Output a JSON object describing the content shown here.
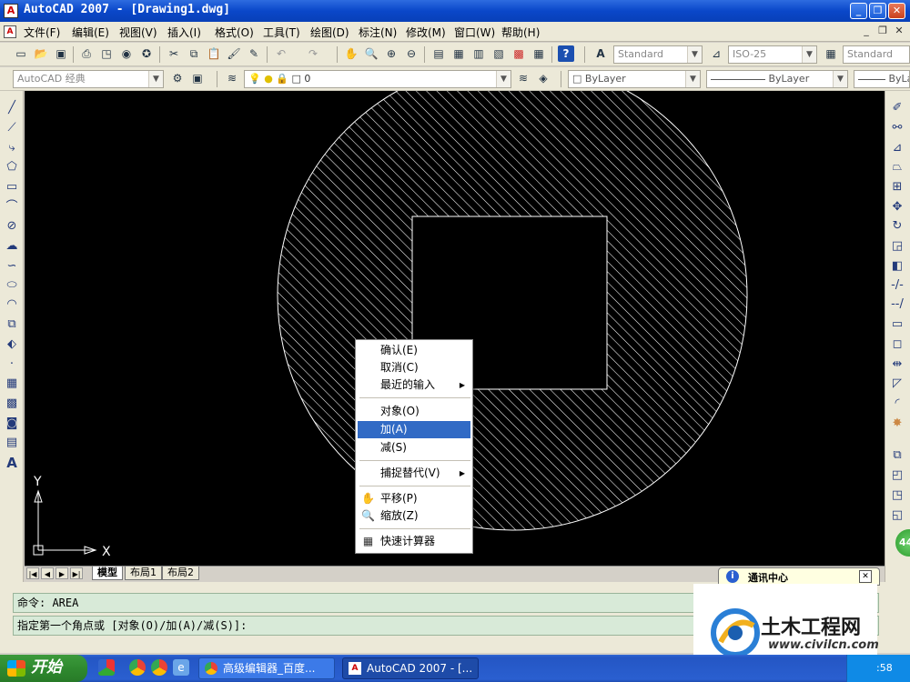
{
  "window": {
    "title": "AutoCAD 2007 - [Drawing1.dwg]",
    "icon_label": "A",
    "buttons": {
      "minimize": "_",
      "restore": "❐",
      "close": "✕"
    }
  },
  "menu": {
    "items": [
      "文件(F)",
      "编辑(E)",
      "视图(V)",
      "插入(I)",
      "格式(O)",
      "工具(T)",
      "绘图(D)",
      "标注(N)",
      "修改(M)",
      "窗口(W)",
      "帮助(H)"
    ],
    "mdi": {
      "minimize": "_",
      "restore": "❐",
      "close": "✕"
    }
  },
  "toolbar": {
    "text_style": "Standard",
    "dim_style": "ISO-25",
    "table_style": "Standard",
    "workspace": "AutoCAD 经典",
    "layer": "0",
    "color": "ByLayer",
    "linetype": "ByLayer",
    "lineweight": "ByLa"
  },
  "ucs": {
    "y_label": "Y",
    "x_label": "X"
  },
  "layout_tabs": [
    "模型",
    "布局1",
    "布局2"
  ],
  "command": {
    "history": "命令:  AREA",
    "prompt": "指定第一个角点或 [对象(O)/加(A)/减(S)]:"
  },
  "context_menu": {
    "items": [
      {
        "label": "确认(E)"
      },
      {
        "label": "取消(C)"
      },
      {
        "label": "最近的输入",
        "submenu": true
      },
      {
        "label": "对象(O)"
      },
      {
        "label": "加(A)",
        "highlighted": true
      },
      {
        "label": "减(S)"
      },
      {
        "label": "捕捉替代(V)",
        "submenu": true
      },
      {
        "label": "平移(P)",
        "icon": "pan-icon"
      },
      {
        "label": "缩放(Z)",
        "icon": "zoom-icon"
      },
      {
        "label": "快速计算器",
        "icon": "calculator-icon"
      }
    ]
  },
  "notification": {
    "title": "通讯中心",
    "close": "✕"
  },
  "badge": "44",
  "watermark": {
    "brand": "土木工程网",
    "url": "www.civilcn.com"
  },
  "taskbar": {
    "start": "开始",
    "tasks": [
      "高级编辑器_百度...",
      "AutoCAD 2007 - [..."
    ],
    "clock": ":58"
  },
  "colors": {
    "title_blue": "#0a47c9",
    "highlight": "#316ac5",
    "command_bg": "#d8ead8",
    "canvas": "#000000",
    "hatch": "#ffffff",
    "start_green": "#2f8a2f"
  }
}
